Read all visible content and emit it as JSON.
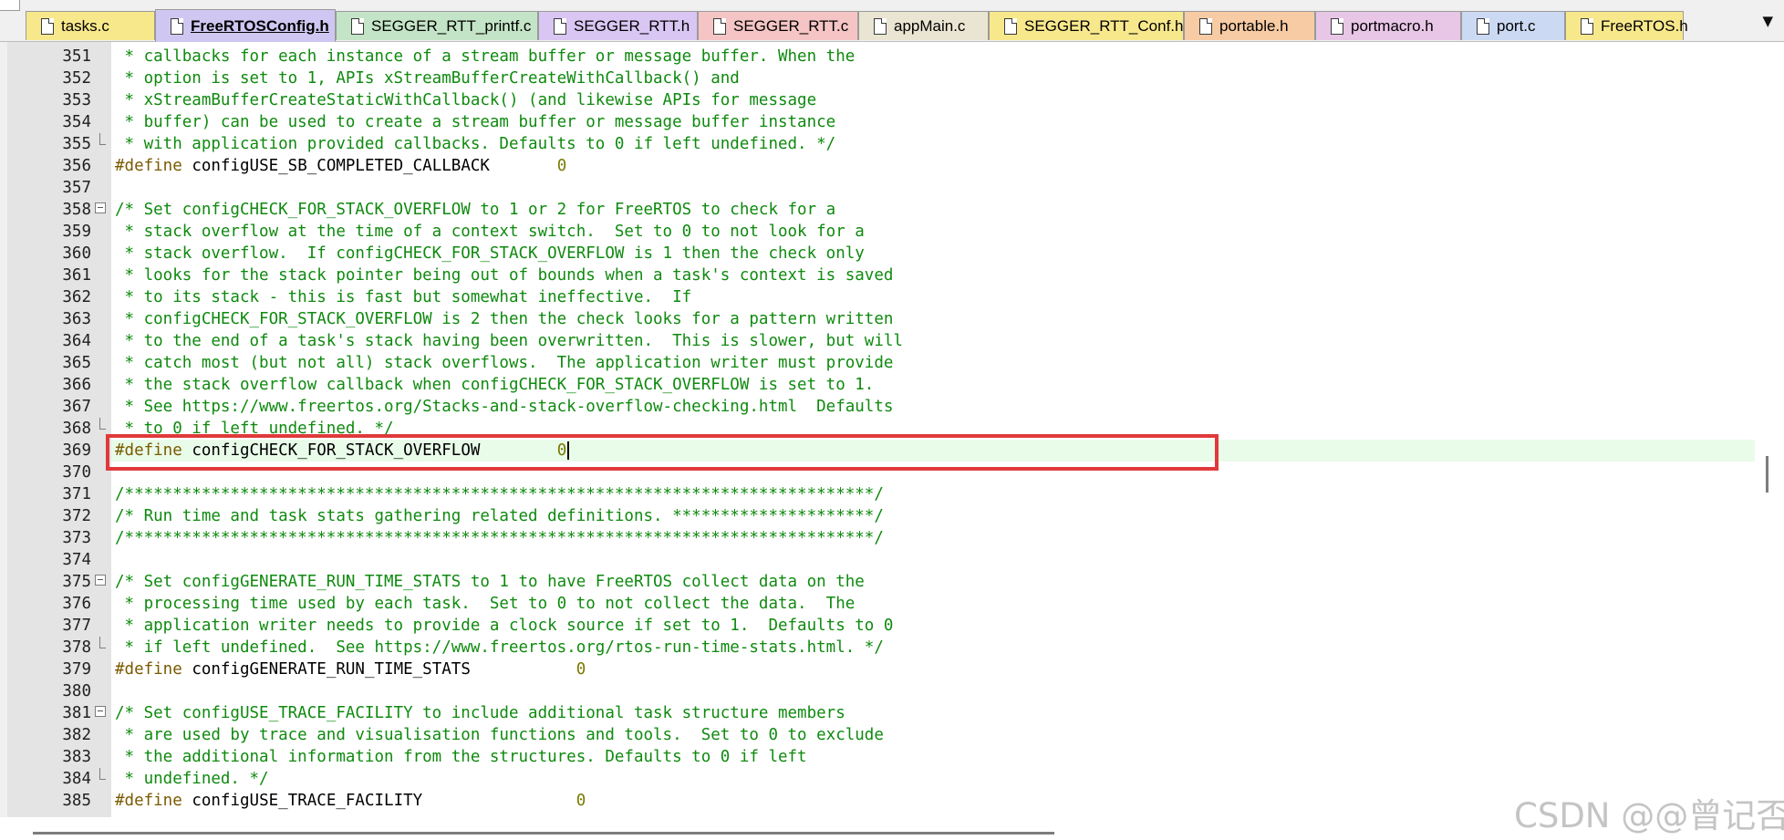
{
  "tabs": [
    {
      "label": "tasks.c",
      "color": "#f8e88c",
      "active": false
    },
    {
      "label": "FreeRTOSConfig.h",
      "color": "#cfc7f2",
      "active": true
    },
    {
      "label": "SEGGER_RTT_printf.c",
      "color": "#c3e4c6",
      "active": false
    },
    {
      "label": "SEGGER_RTT.h",
      "color": "#d9c6f3",
      "active": false
    },
    {
      "label": "SEGGER_RTT.c",
      "color": "#f5c4c4",
      "active": false
    },
    {
      "label": "appMain.c",
      "color": "#eae5d3",
      "active": false
    },
    {
      "label": "SEGGER_RTT_Conf.h",
      "color": "#f8e88c",
      "active": false
    },
    {
      "label": "portable.h",
      "color": "#f7cba3",
      "active": false
    },
    {
      "label": "portmacro.h",
      "color": "#e8c6e6",
      "active": false
    },
    {
      "label": "port.c",
      "color": "#cbd9f3",
      "active": false
    },
    {
      "label": "FreeRTOS.h",
      "color": "#f8e88c",
      "active": false
    }
  ],
  "tab_overflow_icon": "chevron-down-icon",
  "lines": [
    {
      "n": "351",
      "type": "comment",
      "text": " * callbacks for each instance of a stream buffer or message buffer. When the"
    },
    {
      "n": "352",
      "type": "comment",
      "text": " * option is set to 1, APIs xStreamBufferCreateWithCallback() and"
    },
    {
      "n": "353",
      "type": "comment",
      "text": " * xStreamBufferCreateStaticWithCallback() (and likewise APIs for message"
    },
    {
      "n": "354",
      "type": "comment",
      "text": " * buffer) can be used to create a stream buffer or message buffer instance"
    },
    {
      "n": "355",
      "type": "comment",
      "fold": "end",
      "text": " * with application provided callbacks. Defaults to 0 if left undefined. */"
    },
    {
      "n": "356",
      "type": "define",
      "name": "configUSE_SB_COMPLETED_CALLBACK",
      "pad": "       ",
      "value": "0"
    },
    {
      "n": "357",
      "type": "blank",
      "text": ""
    },
    {
      "n": "358",
      "type": "comment",
      "fold": "start",
      "text": "/* Set configCHECK_FOR_STACK_OVERFLOW to 1 or 2 for FreeRTOS to check for a"
    },
    {
      "n": "359",
      "type": "comment",
      "text": " * stack overflow at the time of a context switch.  Set to 0 to not look for a"
    },
    {
      "n": "360",
      "type": "comment",
      "text": " * stack overflow.  If configCHECK_FOR_STACK_OVERFLOW is 1 then the check only"
    },
    {
      "n": "361",
      "type": "comment",
      "text": " * looks for the stack pointer being out of bounds when a task's context is saved"
    },
    {
      "n": "362",
      "type": "comment",
      "text": " * to its stack - this is fast but somewhat ineffective.  If"
    },
    {
      "n": "363",
      "type": "comment",
      "text": " * configCHECK_FOR_STACK_OVERFLOW is 2 then the check looks for a pattern written"
    },
    {
      "n": "364",
      "type": "comment",
      "text": " * to the end of a task's stack having been overwritten.  This is slower, but will"
    },
    {
      "n": "365",
      "type": "comment",
      "text": " * catch most (but not all) stack overflows.  The application writer must provide"
    },
    {
      "n": "366",
      "type": "comment",
      "text": " * the stack overflow callback when configCHECK_FOR_STACK_OVERFLOW is set to 1."
    },
    {
      "n": "367",
      "type": "comment",
      "text": " * See https://www.freertos.org/Stacks-and-stack-overflow-checking.html  Defaults"
    },
    {
      "n": "368",
      "type": "comment",
      "fold": "end",
      "text": " * to 0 if left undefined. */"
    },
    {
      "n": "369",
      "type": "define",
      "highlight": true,
      "name": "configCHECK_FOR_STACK_OVERFLOW",
      "pad": "        ",
      "value": "0"
    },
    {
      "n": "370",
      "type": "blank",
      "text": ""
    },
    {
      "n": "371",
      "type": "comment",
      "text": "/******************************************************************************/"
    },
    {
      "n": "372",
      "type": "comment",
      "text": "/* Run time and task stats gathering related definitions. *********************/"
    },
    {
      "n": "373",
      "type": "comment",
      "text": "/******************************************************************************/"
    },
    {
      "n": "374",
      "type": "blank",
      "text": ""
    },
    {
      "n": "375",
      "type": "comment",
      "fold": "start",
      "text": "/* Set configGENERATE_RUN_TIME_STATS to 1 to have FreeRTOS collect data on the"
    },
    {
      "n": "376",
      "type": "comment",
      "text": " * processing time used by each task.  Set to 0 to not collect the data.  The"
    },
    {
      "n": "377",
      "type": "comment",
      "text": " * application writer needs to provide a clock source if set to 1.  Defaults to 0"
    },
    {
      "n": "378",
      "type": "comment",
      "fold": "end",
      "text": " * if left undefined.  See https://www.freertos.org/rtos-run-time-stats.html. */"
    },
    {
      "n": "379",
      "type": "define",
      "name": "configGENERATE_RUN_TIME_STATS",
      "pad": "           ",
      "value": "0"
    },
    {
      "n": "380",
      "type": "blank",
      "text": ""
    },
    {
      "n": "381",
      "type": "comment",
      "fold": "start",
      "text": "/* Set configUSE_TRACE_FACILITY to include additional task structure members"
    },
    {
      "n": "382",
      "type": "comment",
      "text": " * are used by trace and visualisation functions and tools.  Set to 0 to exclude"
    },
    {
      "n": "383",
      "type": "comment",
      "text": " * the additional information from the structures. Defaults to 0 if left"
    },
    {
      "n": "384",
      "type": "comment",
      "fold": "end",
      "text": " * undefined. */"
    },
    {
      "n": "385",
      "type": "define",
      "name": "configUSE_TRACE_FACILITY",
      "pad": "                ",
      "value": "0"
    }
  ],
  "define_keyword": "#define",
  "watermark": "CSDN @@曾记否"
}
